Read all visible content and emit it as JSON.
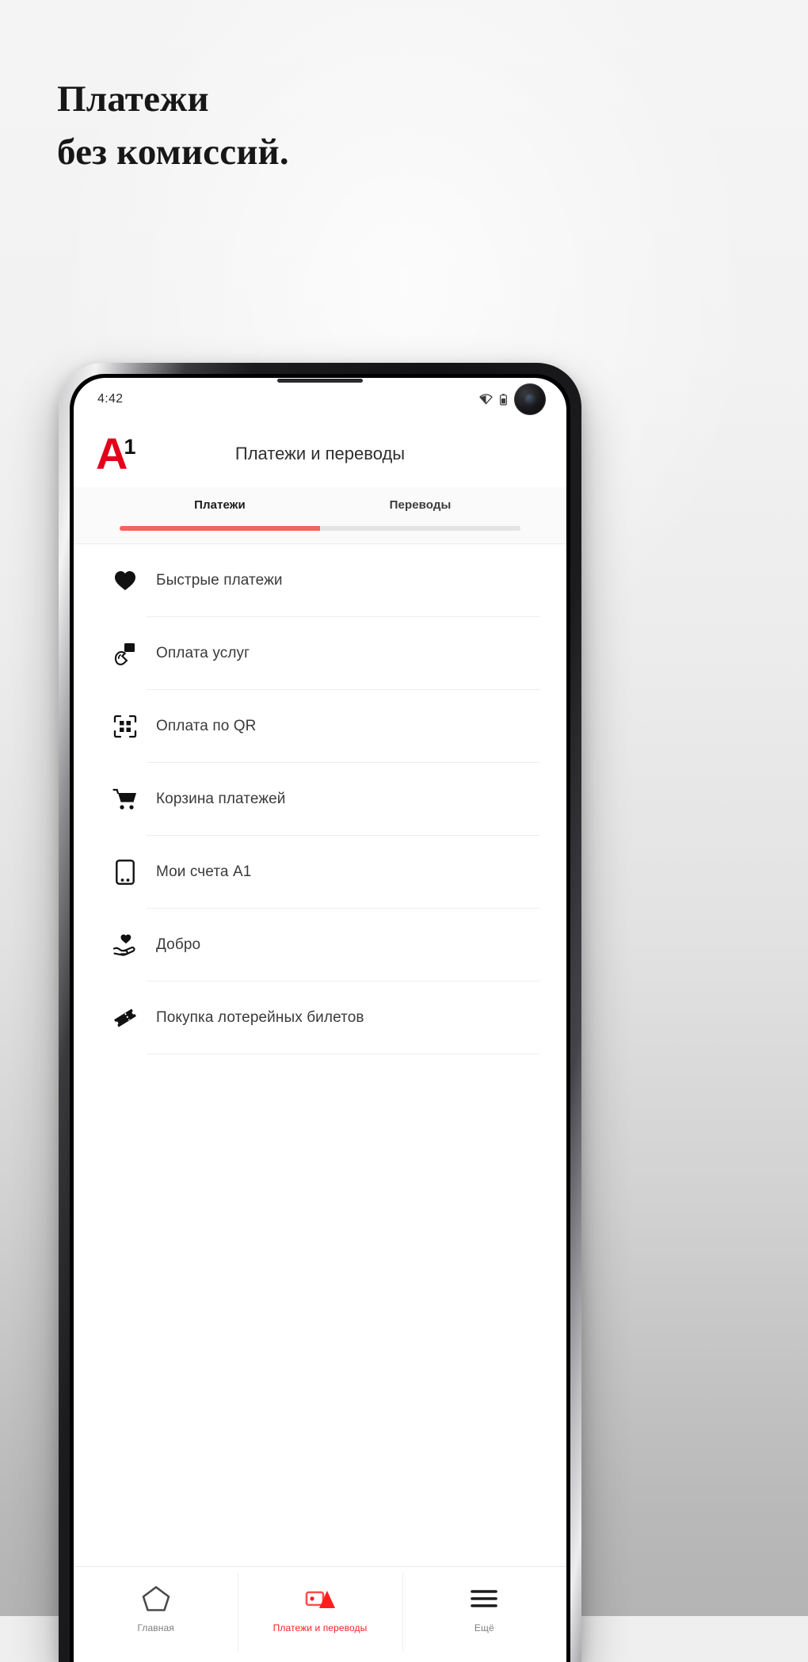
{
  "promo": {
    "headline": "Платежи\nбез комиссий."
  },
  "phone": {
    "statusbar": {
      "time": "4:42",
      "icons": [
        "wifi-icon",
        "battery-icon",
        "front-camera-cutout"
      ]
    },
    "app_header": {
      "logo_letter": "A",
      "logo_digit": "1",
      "title": "Платежи и переводы"
    },
    "tabs": {
      "items": [
        {
          "label": "Платежи",
          "active": true
        },
        {
          "label": "Переводы",
          "active": false
        }
      ],
      "indicator_color": "#f4635c",
      "track_color": "#e4e4e4"
    },
    "menu": {
      "items": [
        {
          "label": "Быстрые платежи",
          "icon": "heart-icon"
        },
        {
          "label": "Оплата услуг",
          "icon": "tap-to-pay-icon"
        },
        {
          "label": "Оплата по QR",
          "icon": "qr-scan-icon"
        },
        {
          "label": "Корзина платежей",
          "icon": "shopping-cart-icon"
        },
        {
          "label": "Мои счета A1",
          "icon": "smartphone-icon"
        },
        {
          "label": "Добро",
          "icon": "hand-heart-icon"
        },
        {
          "label": "Покупка лотерейных билетов",
          "icon": "ticket-icon"
        }
      ]
    },
    "bottom_nav": {
      "items": [
        {
          "label": "Главная",
          "icon": "home-icon",
          "active": false
        },
        {
          "label": "Платежи и переводы",
          "icon": "payments-icon",
          "active": true
        },
        {
          "label": "Ещё",
          "icon": "menu-burger-icon",
          "active": false
        }
      ],
      "active_color": "#ff1f1f",
      "inactive_color": "#7d7d7d"
    }
  },
  "brand": {
    "red": "#e3001b"
  }
}
